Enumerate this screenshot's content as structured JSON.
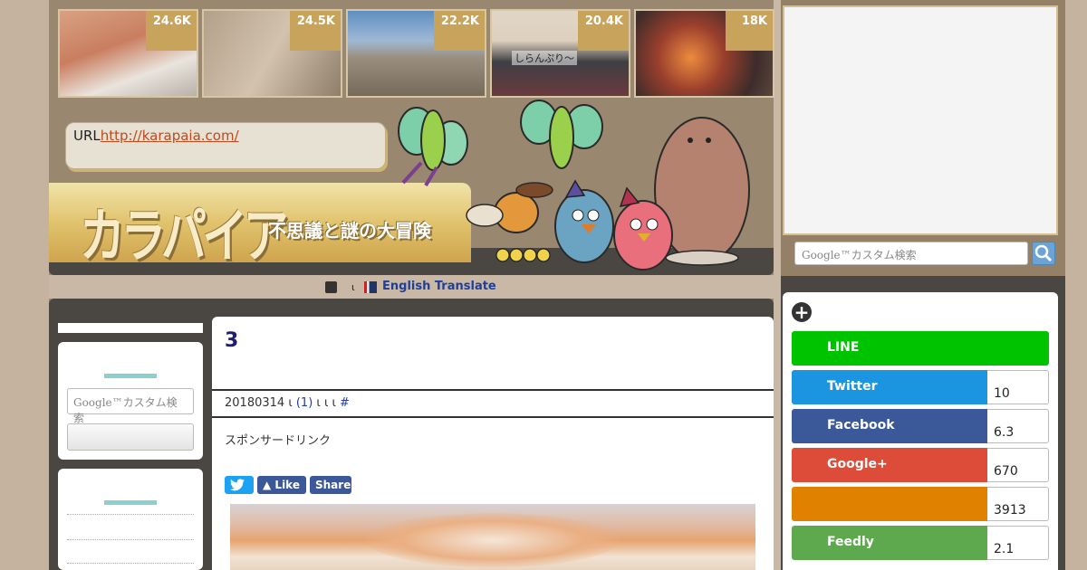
{
  "popular": [
    {
      "count": "24.6K"
    },
    {
      "count": "24.5K"
    },
    {
      "count": "22.2K"
    },
    {
      "count": "20.4K",
      "caption": "しらんぷり〜"
    },
    {
      "count": "18K"
    }
  ],
  "header": {
    "url_label": "URL",
    "url_link": "http://karapaia.com/",
    "logo": "カラパイア",
    "tagline": "不思議と謎の大冒険"
  },
  "translate": {
    "separator": "ι",
    "link": "English Translate"
  },
  "left_sidebar": {
    "search_placeholder": "Google™カスタム検索"
  },
  "article": {
    "title": "3",
    "meta_date": "20180314",
    "meta_sep1": "ι",
    "meta_comments": "(1)",
    "meta_rest": "ι ι",
    "meta_sep2": "ι",
    "meta_hash": "#",
    "sponsor": "スポンサードリンク",
    "share": {
      "like": "Like",
      "share": "Share"
    }
  },
  "right_sidebar": {
    "search_placeholder": "Google™カスタム検索",
    "services": [
      {
        "name": "LINE",
        "count": "",
        "color": "#00c300"
      },
      {
        "name": "Twitter",
        "count": "10",
        "color": "#1b95e0"
      },
      {
        "name": "Facebook",
        "count": "6.3",
        "color": "#3b5998"
      },
      {
        "name": "Google+",
        "count": "670",
        "color": "#dd4b39"
      },
      {
        "name": "",
        "count": "3913",
        "color": "#e08100"
      },
      {
        "name": "Feedly",
        "count": "2.1",
        "color": "#5ea94e"
      }
    ]
  }
}
